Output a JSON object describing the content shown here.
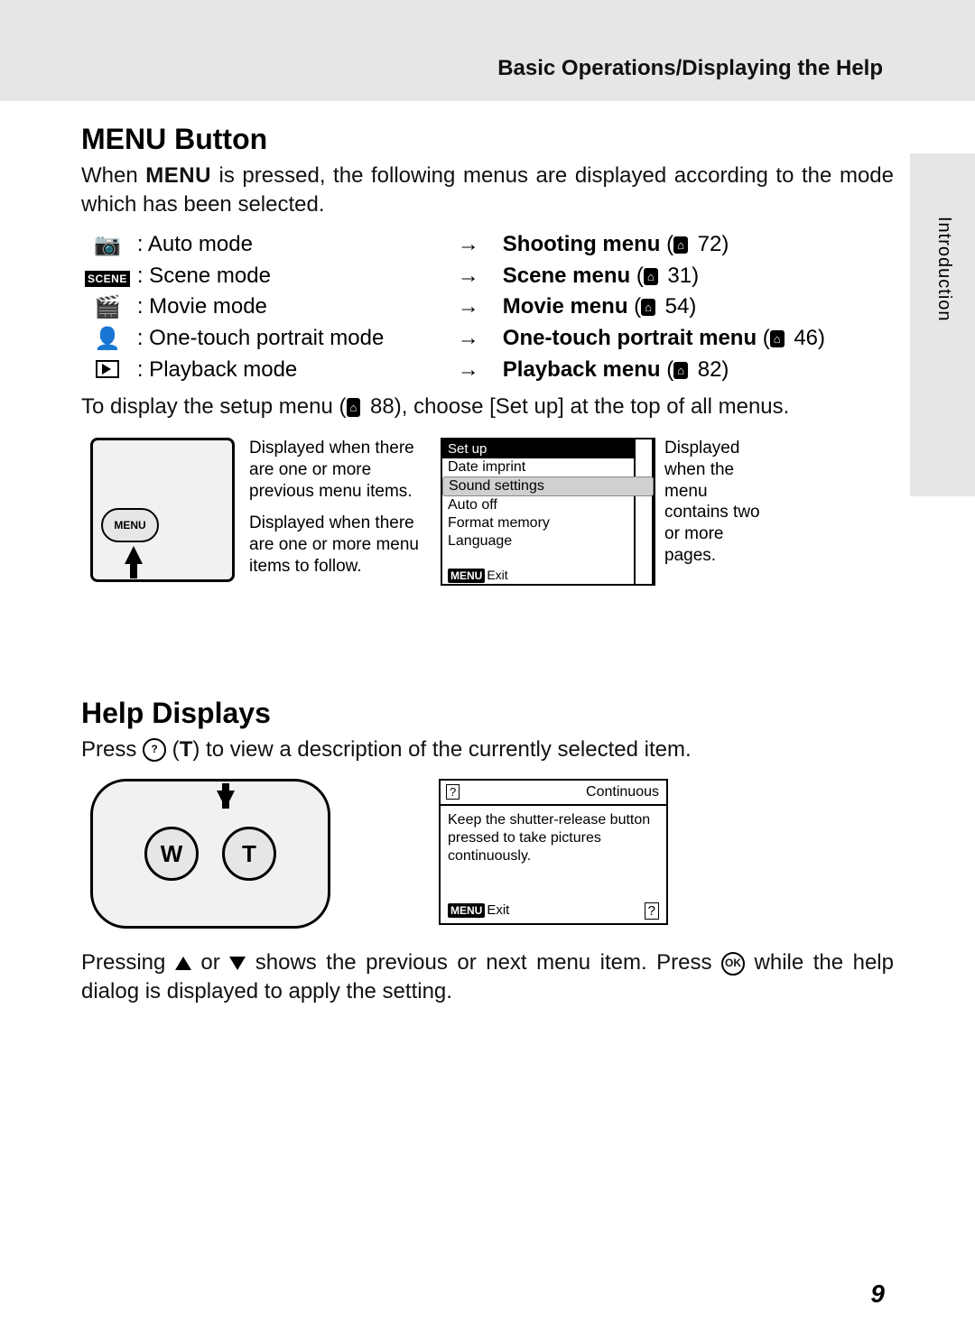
{
  "header": {
    "breadcrumb": "Basic Operations/Displaying the Help"
  },
  "side_tab": "Introduction",
  "section1": {
    "title": "MENU Button",
    "intro_pre": "When ",
    "intro_menu": "MENU",
    "intro_post": " is pressed, the following menus are displayed according to the mode which has been selected.",
    "modes": [
      {
        "icon_name": "camera-icon",
        "icon_text": "📷",
        "mode": "Auto mode",
        "menu": "Shooting menu",
        "page": "72"
      },
      {
        "icon_name": "scene-icon",
        "icon_text": "SCENE",
        "mode": "Scene mode",
        "menu": "Scene menu",
        "page": "31"
      },
      {
        "icon_name": "movie-icon",
        "icon_text": "🎬",
        "mode": "Movie mode",
        "menu": "Movie menu",
        "page": "54"
      },
      {
        "icon_name": "portrait-icon",
        "icon_text": "👤",
        "mode": "One-touch portrait mode",
        "menu": "One-touch portrait menu",
        "page": "46"
      },
      {
        "icon_name": "playback-icon",
        "icon_text": "▶",
        "mode": "Playback mode",
        "menu": "Playback menu",
        "page": "82"
      }
    ],
    "setup_pre": "To display the setup menu (",
    "setup_page": "88",
    "setup_post": "), choose [Set up] at the top of all menus.",
    "note_prev": "Displayed when there are one or more previous menu items.",
    "note_next": "Displayed when there are one or more menu items to follow.",
    "note_pages": "Displayed when the menu contains two or more pages.",
    "menu_screen": {
      "title": "Set up",
      "items": [
        "Date imprint",
        "Sound settings",
        "Auto off",
        "Format memory",
        "Language"
      ],
      "exit": "Exit",
      "menu_label": "MENU"
    },
    "menu_btn_label": "MENU"
  },
  "section2": {
    "title": "Help Displays",
    "line1_pre": "Press ",
    "line1_help_icon": "?",
    "line1_t": "T",
    "line1_post": " to view a description of the currently selected item.",
    "wt_w": "W",
    "wt_t": "T",
    "help_box": {
      "q": "?",
      "title": "Continuous",
      "body": "Keep the shutter-release button pressed to take pictures continuously.",
      "menu_label": "MENU",
      "exit": "Exit",
      "q2": "?"
    },
    "line2_pre": "Pressing ",
    "line2_mid": " or ",
    "line2_post1": " shows the previous or next menu item. Press ",
    "line2_ok": "OK",
    "line2_post2": " while the help dialog is displayed to apply the setting."
  },
  "page_number": "9"
}
